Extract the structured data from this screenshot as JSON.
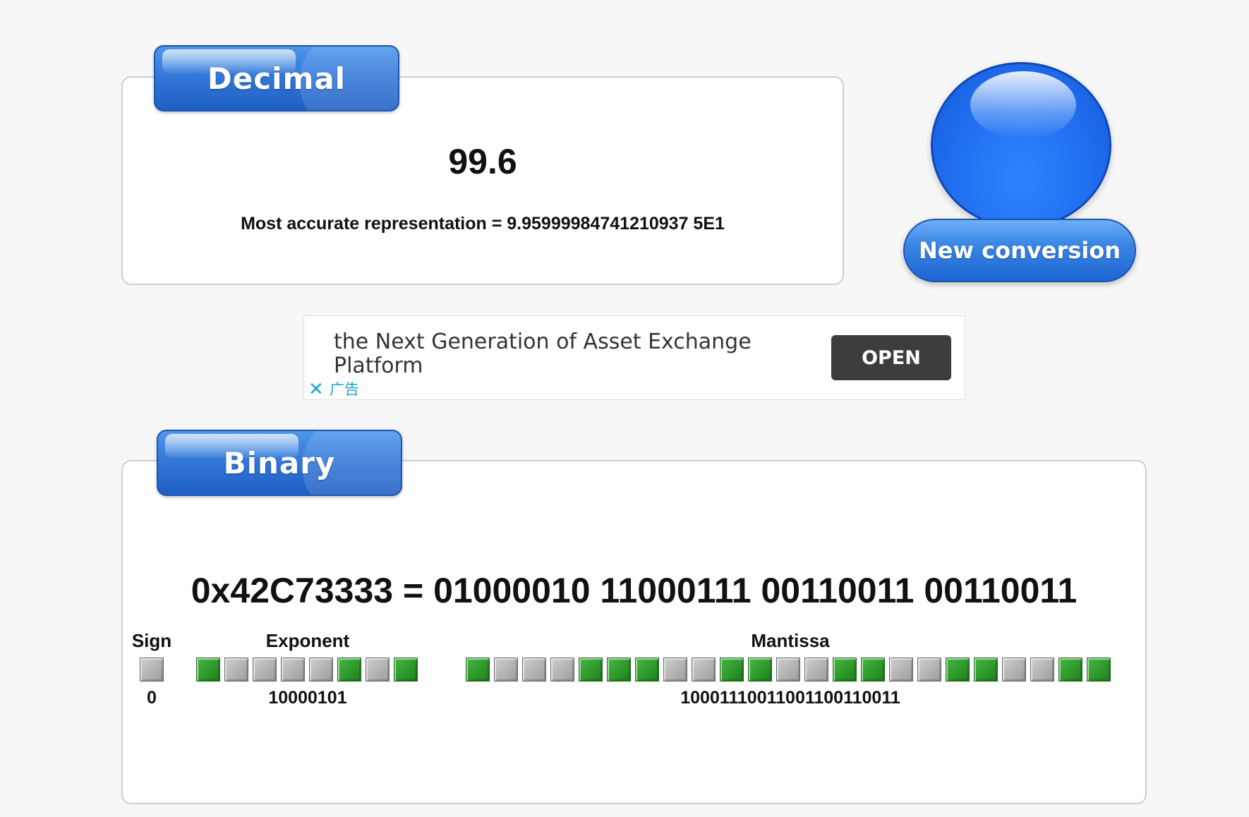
{
  "decimal": {
    "tab_label": "Decimal",
    "value": "99.6",
    "accurate_representation": "Most accurate representation = 9.95999984741210937 5E1"
  },
  "new_conversion": {
    "label": "New conversion",
    "ball_color": "#1f6ff0"
  },
  "ad": {
    "text": "the Next Generation of Asset Exchange Platform",
    "button_label": "OPEN",
    "close_icon": "close-icon",
    "label": "广告"
  },
  "binary": {
    "tab_label": "Binary",
    "hex_line": "0x42C73333 = 01000010 11000111 00110011 00110011",
    "fields": {
      "sign": {
        "label": "Sign",
        "bits": "0",
        "value": "0"
      },
      "exponent": {
        "label": "Exponent",
        "bits": "10000101",
        "value": "10000101"
      },
      "mantissa": {
        "label": "Mantissa",
        "bits": "10001110011001100110011",
        "value": "10001110011001100110011"
      }
    }
  },
  "colors": {
    "accent_blue": "#3478d9",
    "bit_on": "#2f9a2c",
    "bit_off": "#b3b3b3",
    "ad_button": "#3d3d3d",
    "ad_label": "#1aa3d6"
  }
}
